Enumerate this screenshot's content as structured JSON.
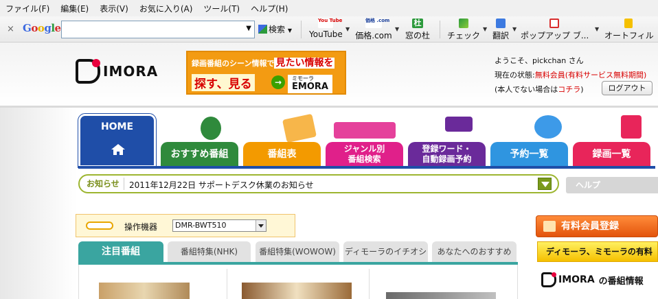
{
  "menubar": [
    "ファイル(F)",
    "編集(E)",
    "表示(V)",
    "お気に入り(A)",
    "ツール(T)",
    "ヘルプ(H)"
  ],
  "toolbar": {
    "close": "×",
    "google_logo": "Google",
    "search_value": "",
    "search_button": "検索",
    "buttons": [
      "YouTube",
      "価格.com",
      "窓の杜",
      "チェック",
      "翻訳",
      "ポップアップ ブ...",
      "オートフィル"
    ],
    "button_icon_labels": [
      "You Tube",
      "価格 .com",
      "杜"
    ],
    "icons": [
      "youtube-icon",
      "kakaku-icon",
      "madonomori-icon",
      "check-icon",
      "translate-icon",
      "popup-block-icon",
      "autofill-icon"
    ]
  },
  "header": {
    "logo_text": "IMORA",
    "banner": {
      "line1_prefix": "録画番組のシーン情報で",
      "line1_highlight": "見たい情報を",
      "line2": "探す、見る",
      "brand_small": "ミモーラ",
      "brand": "EMORA"
    },
    "welcome": {
      "greeting": "ようこそ、pickchan さん",
      "status_label": "現在の状態:",
      "status_value": "無料会員(有料サービス無料期間)",
      "not_you_prefix": "(本人でない場合は",
      "not_you_link": "コチラ",
      "not_you_suffix": ")",
      "logout": "ログアウト"
    }
  },
  "nav": {
    "home": "HOME",
    "tabs": [
      {
        "label": "おすすめ番組",
        "color": "#2f8a3c"
      },
      {
        "label": "番組表",
        "color": "#f39a00"
      },
      {
        "label": "ジャンル別\n番組検索",
        "color": "#e0208a"
      },
      {
        "label": "登録ワード・\n自動録画予約",
        "color": "#6a2a9a"
      },
      {
        "label": "予約一覧",
        "color": "#2f95e0"
      },
      {
        "label": "録画一覧",
        "color": "#e8255a"
      }
    ]
  },
  "notice": {
    "label": "お知らせ",
    "text": "2011年12月22日 サポートデスク休業のお知らせ",
    "help": "ヘルプ"
  },
  "device": {
    "label": "操作機器",
    "selected": "DMR-BWT510"
  },
  "content_tabs": [
    {
      "label": "注目番組",
      "active": true
    },
    {
      "label": "番組特集(NHK)",
      "active": false
    },
    {
      "label": "番組特集(WOWOW)",
      "active": false
    },
    {
      "label": "ディモーラのイチオシ",
      "active": false
    },
    {
      "label": "あなたへのおすすめ",
      "active": false
    }
  ],
  "right": {
    "paid": "有料会員登録",
    "dimora_promo": "ディモーラ、ミモーラの有料",
    "logo_text": "IMORA",
    "logo_suffix": "の番組情報"
  }
}
